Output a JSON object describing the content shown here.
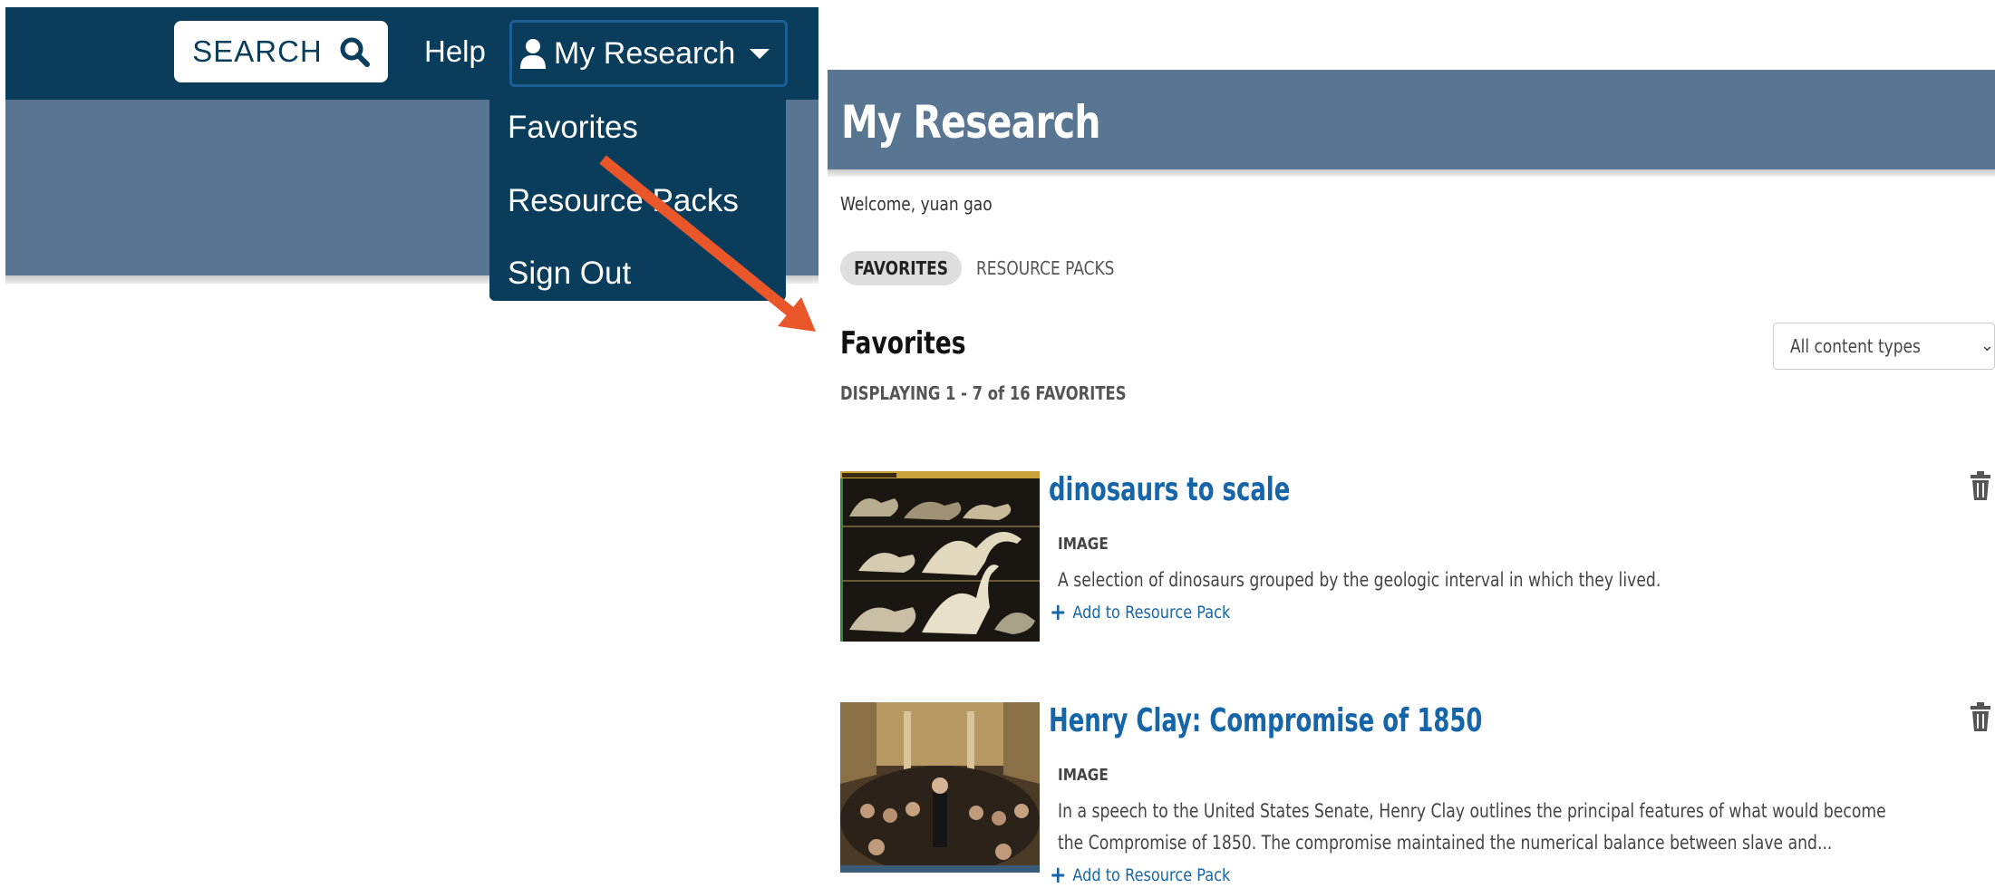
{
  "header": {
    "search_label": "SEARCH",
    "help_label": "Help",
    "my_research_label": "My Research"
  },
  "dropdown": {
    "items": [
      {
        "label": "Favorites"
      },
      {
        "label": "Resource Packs"
      },
      {
        "label": "Sign Out"
      }
    ]
  },
  "annotation": {
    "arrow_color": "#e8562a"
  },
  "page": {
    "title": "My Research",
    "welcome": "Welcome, yuan gao",
    "tabs": [
      {
        "label": "FAVORITES",
        "active": true
      },
      {
        "label": "RESOURCE PACKS",
        "active": false
      }
    ],
    "section_heading": "Favorites",
    "displaying": "DISPLAYING 1 - 7 of 16 FAVORITES",
    "filter": {
      "selected": "All content types"
    }
  },
  "favorites": [
    {
      "title": "dinosaurs to scale",
      "type": "IMAGE",
      "description": "A selection of dinosaurs grouped by the geologic interval in which they lived.",
      "add_label": "Add to Resource Pack"
    },
    {
      "title": "Henry Clay: Compromise of 1850",
      "type": "IMAGE",
      "description": "In a speech to the United States Senate, Henry Clay outlines the principal features of what would become the Compromise of 1850. The compromise maintained the numerical balance between slave and...",
      "add_label": "Add to Resource Pack"
    }
  ],
  "colors": {
    "navy": "#0a3d5c",
    "slate": "#587592",
    "link_blue": "#1565a8",
    "arrow_orange": "#e8562a"
  }
}
